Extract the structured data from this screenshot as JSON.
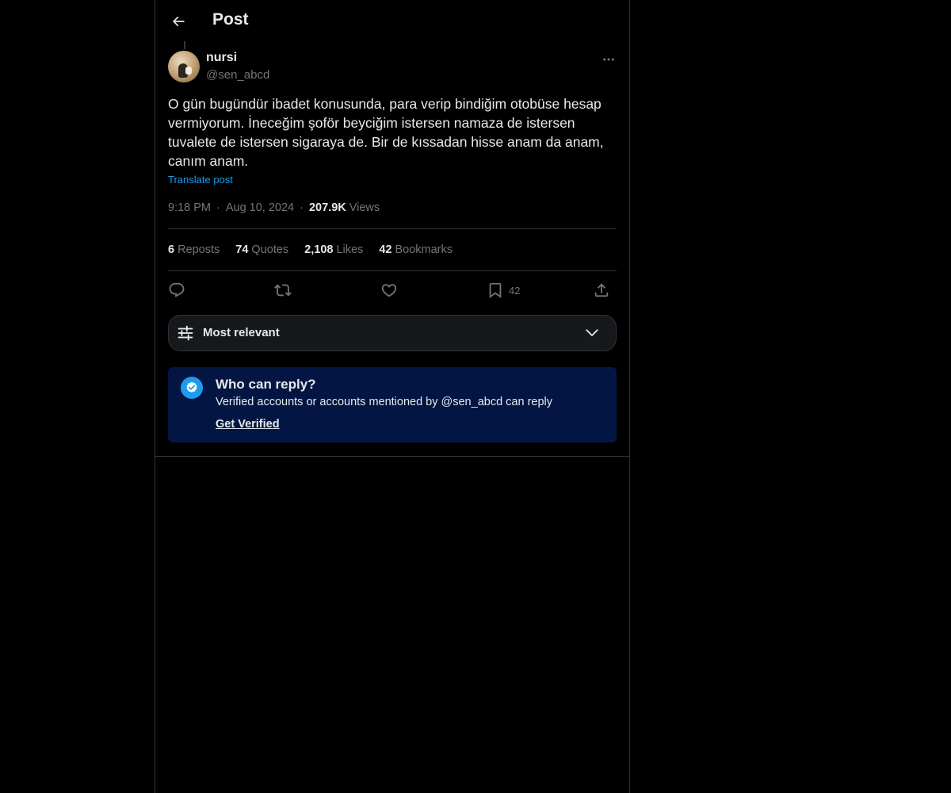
{
  "header": {
    "title": "Post"
  },
  "author": {
    "display_name": "nursi",
    "handle": "@sen_abcd"
  },
  "post": {
    "text": "O gün bugündür ibadet konusunda, para verip bindiğim otobüse hesap vermiyorum. İneceğim şoför beyciğim istersen namaza de istersen tuvalete de istersen sigaraya de. Bir de kıssadan hisse anam da anam, canım anam.",
    "translate_label": "Translate post",
    "time": "9:18 PM",
    "date": "Aug 10, 2024",
    "views_count": "207.9K",
    "views_label": "Views",
    "separator": "·"
  },
  "stats": {
    "reposts": {
      "count": "6",
      "label": "Reposts"
    },
    "quotes": {
      "count": "74",
      "label": "Quotes"
    },
    "likes": {
      "count": "2,108",
      "label": "Likes"
    },
    "bookmarks": {
      "count": "42",
      "label": "Bookmarks"
    }
  },
  "actions": {
    "reply": {
      "icon": "reply-icon"
    },
    "repost": {
      "icon": "repost-icon"
    },
    "like": {
      "icon": "heart-icon"
    },
    "bookmark": {
      "icon": "bookmark-icon",
      "count": "42"
    },
    "share": {
      "icon": "share-icon"
    }
  },
  "sort": {
    "label": "Most relevant"
  },
  "reply_restriction": {
    "title": "Who can reply?",
    "description": "Verified accounts or accounts mentioned by @sen_abcd can reply",
    "link": "Get Verified"
  },
  "colors": {
    "background": "#000000",
    "text": "#e7e9ea",
    "muted": "#71767b",
    "accent": "#1d9bf0",
    "border": "#2f3336",
    "reply_box_bg": "#031643"
  }
}
